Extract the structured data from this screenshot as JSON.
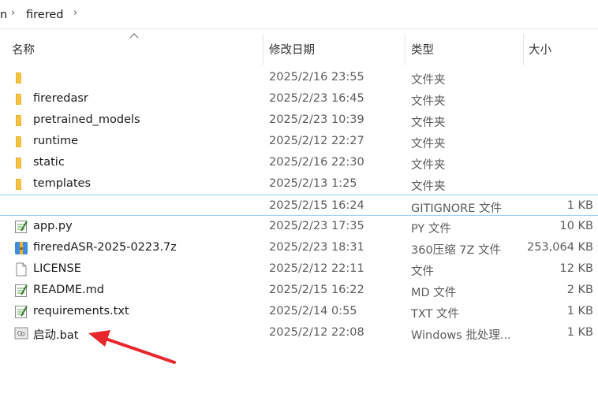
{
  "breadcrumb": {
    "fragment": "n",
    "sep": "›",
    "folder": "firered"
  },
  "columns": {
    "name": "名称",
    "date": "修改日期",
    "type": "类型",
    "size": "大小"
  },
  "rows": [
    {
      "name": "",
      "date": "2025/2/16 23:55",
      "type": "文件夹",
      "size": "",
      "icon": "folder-icon"
    },
    {
      "name": "fireredasr",
      "date": "2025/2/23 16:45",
      "type": "文件夹",
      "size": "",
      "icon": "folder-icon"
    },
    {
      "name": "pretrained_models",
      "date": "2025/2/23 10:39",
      "type": "文件夹",
      "size": "",
      "icon": "folder-icon"
    },
    {
      "name": "runtime",
      "date": "2025/2/12 22:27",
      "type": "文件夹",
      "size": "",
      "icon": "folder-icon"
    },
    {
      "name": "static",
      "date": "2025/2/16 22:30",
      "type": "文件夹",
      "size": "",
      "icon": "folder-icon"
    },
    {
      "name": "templates",
      "date": "2025/2/13 1:25",
      "type": "文件夹",
      "size": "",
      "icon": "folder-icon"
    },
    {
      "name": "",
      "date": "2025/2/15 16:24",
      "type": "GITIGNORE 文件",
      "size": "1 KB",
      "icon": ""
    },
    {
      "name": "app.py",
      "date": "2025/2/23 17:35",
      "type": "PY 文件",
      "size": "10 KB",
      "icon": "text-file-icon"
    },
    {
      "name": "fireredASR-2025-0223.7z",
      "date": "2025/2/23 18:31",
      "type": "360压缩 7Z 文件",
      "size": "253,064 KB",
      "icon": "archive-icon"
    },
    {
      "name": "LICENSE",
      "date": "2025/2/12 22:11",
      "type": "文件",
      "size": "12 KB",
      "icon": "blank-file-icon"
    },
    {
      "name": "README.md",
      "date": "2025/2/15 16:22",
      "type": "MD 文件",
      "size": "2 KB",
      "icon": "text-file-icon"
    },
    {
      "name": "requirements.txt",
      "date": "2025/2/14 0:55",
      "type": "TXT 文件",
      "size": "1 KB",
      "icon": "text-file-icon"
    },
    {
      "name": "启动.bat",
      "date": "2025/2/12 22:08",
      "type": "Windows 批处理...",
      "size": "1 KB",
      "icon": "batch-file-icon"
    }
  ],
  "colors": {
    "folder": "#f5c342",
    "selection": "#99d1ff",
    "arrow": "#e8262b"
  }
}
